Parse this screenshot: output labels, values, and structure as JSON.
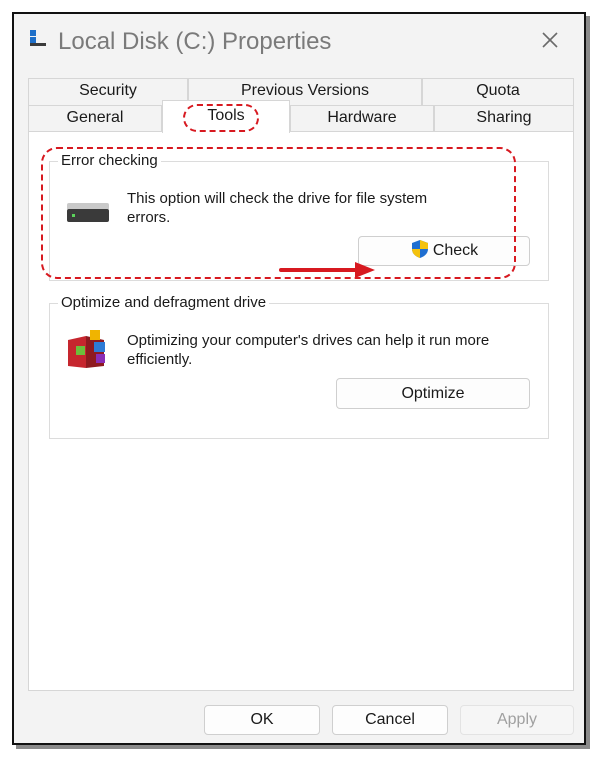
{
  "window": {
    "title": "Local Disk (C:) Properties"
  },
  "tabs": {
    "row1": [
      "Security",
      "Previous Versions",
      "Quota"
    ],
    "row2": [
      "General",
      "Tools",
      "Hardware",
      "Sharing"
    ],
    "active": "Tools"
  },
  "error_checking": {
    "label": "Error checking",
    "description": "This option will check the drive for file system errors.",
    "button": "Check"
  },
  "optimize": {
    "label": "Optimize and defragment drive",
    "description": "Optimizing your computer's drives can help it run more efficiently.",
    "button": "Optimize"
  },
  "footer": {
    "ok": "OK",
    "cancel": "Cancel",
    "apply": "Apply"
  },
  "colors": {
    "annotation": "#d71920",
    "disabled_text": "#a0a0a0"
  },
  "icons": [
    "windows-drive-icon",
    "close-icon",
    "hard-drive-icon",
    "uac-shield-icon",
    "defrag-icon",
    "arrow-annotation"
  ]
}
